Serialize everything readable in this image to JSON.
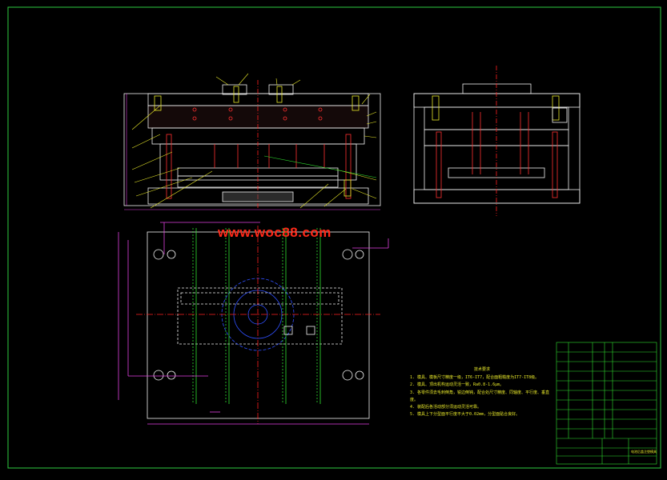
{
  "watermark": "www.woc88.com",
  "technical_notes": {
    "title": "技术要求",
    "items": [
      "1. 模具、模板尺寸精度一级，IT6-IT7，配合面粗糙度为IT7-IT8级。",
      "2. 模具、顶出机构运动灵活一致，Ra0.8-1.6μm。",
      "3. 各零件须去毛刺倒角，锐边倒钝，配合处尺寸精度、同轴度、平行度、垂直度。",
      "4. 装配后各活动部分须运动灵活可靠。",
      "5. 模具上下分型面平行度不大于0.02mm，分型面贴合良好。"
    ]
  },
  "title_block": {
    "drawing_name": "电池后盖注塑模具"
  },
  "colors": {
    "background": "#000000",
    "frame": "#2ecc40",
    "outline": "#f0f0f0",
    "component": "#ff3030",
    "bolt": "#30e030",
    "dimension": "#e040e0",
    "leader": "#e8e82a",
    "cavity": "#3050ff",
    "centerline": "#ff2020"
  }
}
